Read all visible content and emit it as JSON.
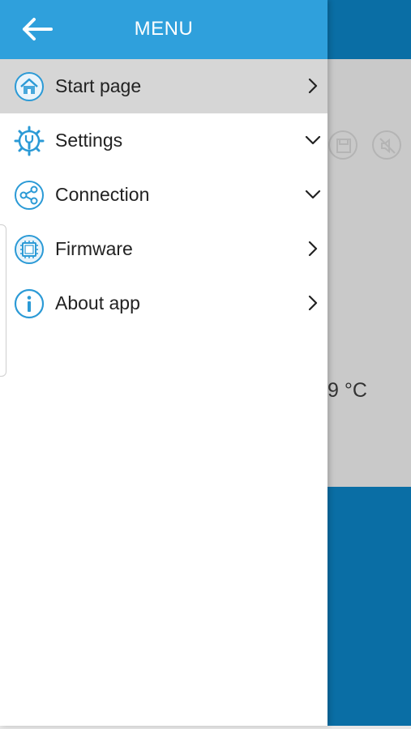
{
  "header": {
    "title": "MENU"
  },
  "menu": {
    "items": [
      {
        "label": "Start page",
        "icon": "home-icon",
        "indicator": "chevron-right"
      },
      {
        "label": "Settings",
        "icon": "settings-icon",
        "indicator": "chevron-down"
      },
      {
        "label": "Connection",
        "icon": "share-icon",
        "indicator": "chevron-down"
      },
      {
        "label": "Firmware",
        "icon": "chip-icon",
        "indicator": "chevron-right"
      },
      {
        "label": "About app",
        "icon": "info-icon",
        "indicator": "chevron-right"
      }
    ]
  },
  "background": {
    "temperature": "9 °C"
  },
  "colors": {
    "header": "#2fa0dc",
    "accent": "#2b9ad6",
    "active_row": "#d6d6d6",
    "background_header": "#0a6ea5"
  }
}
